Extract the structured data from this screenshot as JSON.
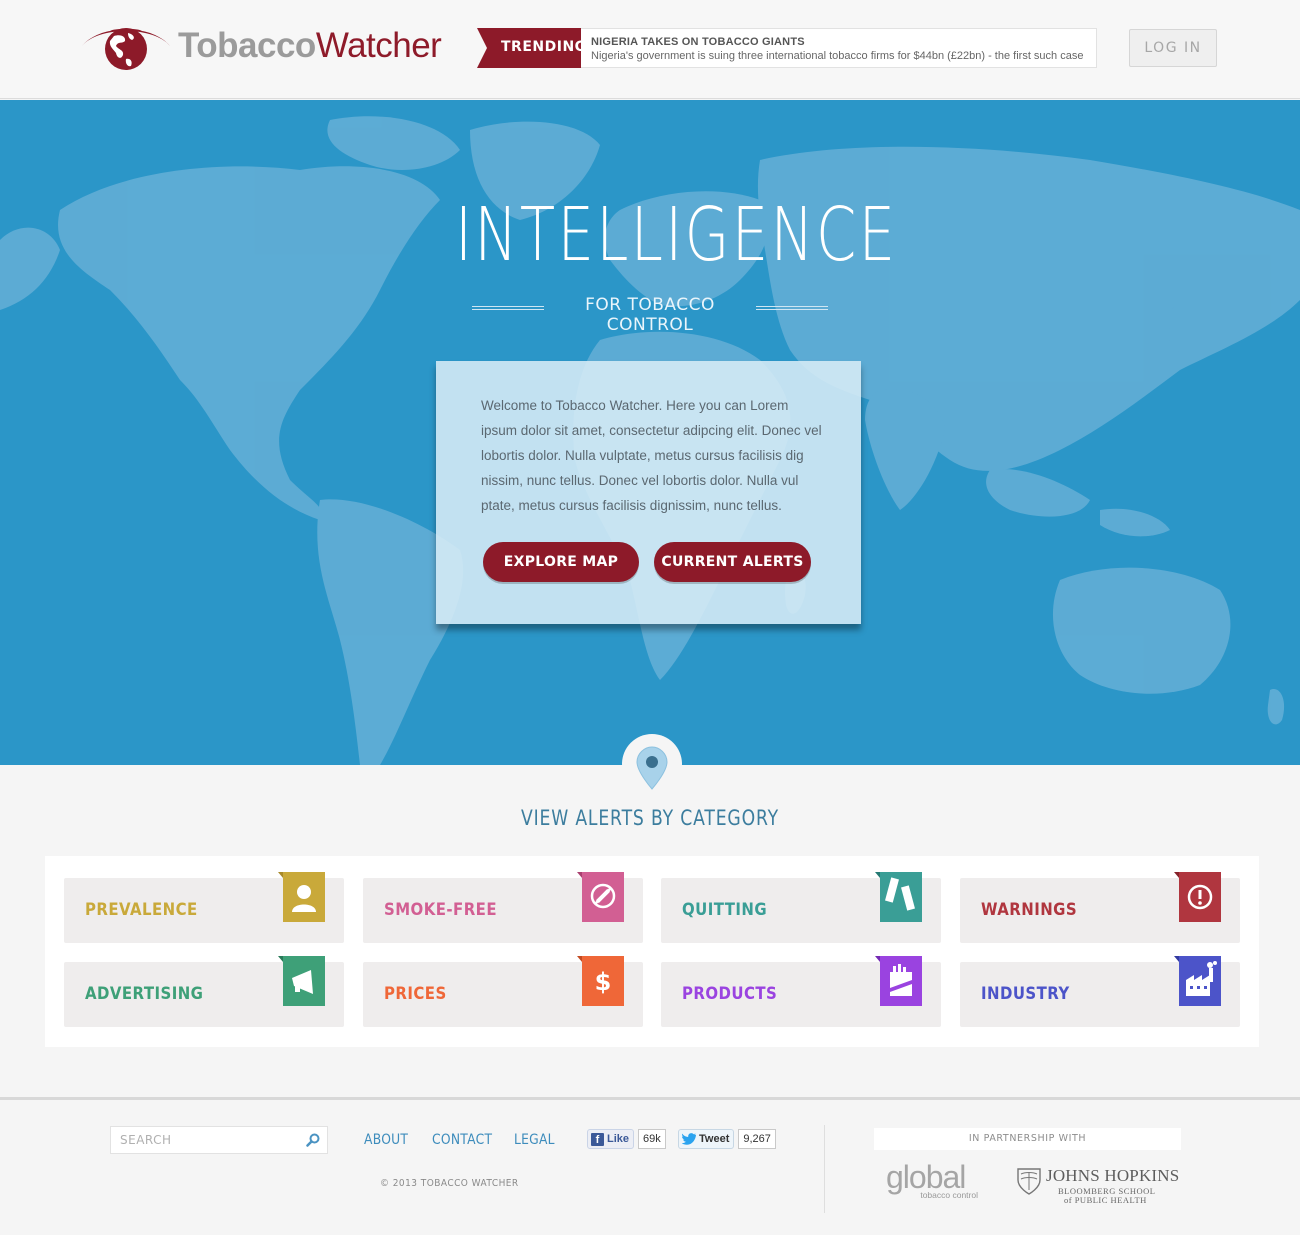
{
  "brand": {
    "name_part1": "Tobacco",
    "name_part2": "Watcher",
    "color": "#8d1a29"
  },
  "header": {
    "trending_label": "TRENDING",
    "trending_title": "NIGERIA TAKES ON TOBACCO GIANTS",
    "trending_text": "Nigeria's government is suing three international tobacco firms for $44bn (£22bn) - the first such case",
    "login_label": "LOG IN"
  },
  "hero": {
    "title": "INTELLIGENCE",
    "subtitle": "FOR TOBACCO CONTROL",
    "welcome_text": "Welcome to Tobacco Watcher. Here you can Lorem ipsum dolor sit amet, consectetur adipcing elit. Donec vel lobortis dolor. Nulla vulptate, metus cursus facilisis dig nissim, nunc tellus. Donec vel lobortis dolor. Nulla vul ptate, metus cursus facilisis dignissim, nunc tellus.",
    "explore_button": "EXPLORE MAP",
    "alerts_button": "CURRENT ALERTS",
    "background_color": "#2b96c8"
  },
  "categories": {
    "heading": "VIEW ALERTS BY CATEGORY",
    "items": [
      {
        "label": "PREVALENCE",
        "color": "#c9a93a",
        "icon": "person-icon"
      },
      {
        "label": "SMOKE-FREE",
        "color": "#d25f93",
        "icon": "no-smoking-icon"
      },
      {
        "label": "QUITTING",
        "color": "#3a9e96",
        "icon": "broken-cigarette-icon"
      },
      {
        "label": "WARNINGS",
        "color": "#b0363f",
        "icon": "alert-icon"
      },
      {
        "label": "ADVERTISING",
        "color": "#3ea078",
        "icon": "megaphone-icon"
      },
      {
        "label": "PRICES",
        "color": "#ef6738",
        "icon": "dollar-icon"
      },
      {
        "label": "PRODUCTS",
        "color": "#9a43e0",
        "icon": "cigarette-pack-icon"
      },
      {
        "label": "INDUSTRY",
        "color": "#4c54c9",
        "icon": "factory-icon"
      }
    ]
  },
  "footer": {
    "search_placeholder": "SEARCH",
    "links": [
      "ABOUT",
      "CONTACT",
      "LEGAL"
    ],
    "like_label": "Like",
    "like_count": "69k",
    "tweet_label": "Tweet",
    "tweet_count": "9,267",
    "copyright": "© 2013 TOBACCO WATCHER",
    "partnership_label": "IN PARTNERSHIP WITH",
    "partner1_name": "global",
    "partner1_sub": "tobacco control",
    "partner2_name": "JOHNS HOPKINS",
    "partner2_sub1": "BLOOMBERG SCHOOL",
    "partner2_sub2": "of PUBLIC HEALTH"
  }
}
